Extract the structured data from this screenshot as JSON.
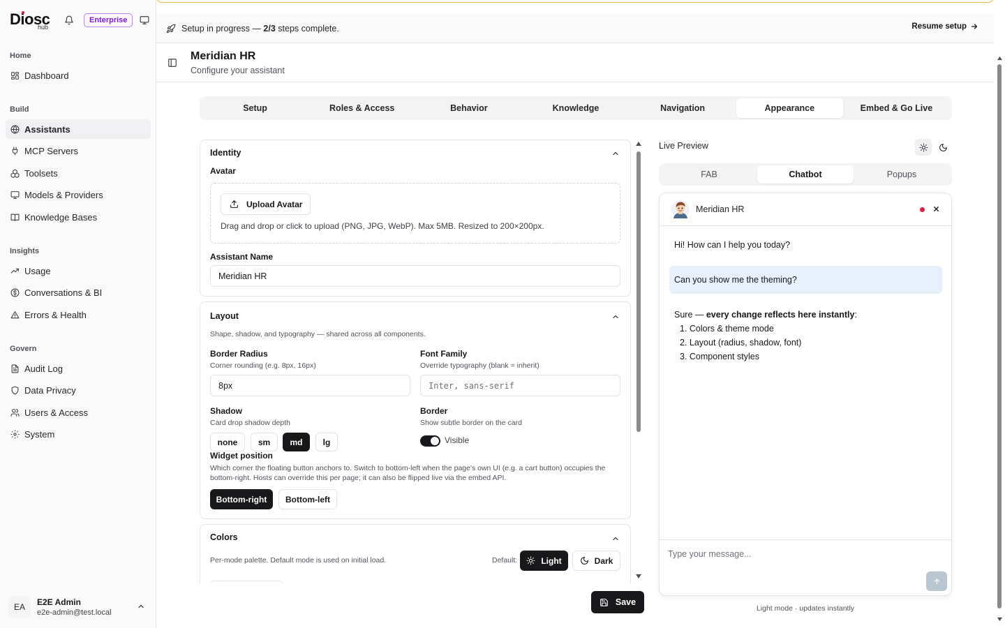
{
  "brand": {
    "logo_text": "Diosc",
    "logo_sub": "hub",
    "plan_badge": "Enterprise",
    "icons": [
      "bell-icon",
      "monitor-icon"
    ]
  },
  "sidebar": {
    "sections": [
      {
        "label": "Home",
        "items": [
          {
            "label": "Dashboard",
            "icon": "dashboard-icon"
          }
        ]
      },
      {
        "label": "Build",
        "items": [
          {
            "label": "Assistants",
            "icon": "globe-icon",
            "active": true
          },
          {
            "label": "MCP Servers",
            "icon": "plug-icon"
          },
          {
            "label": "Toolsets",
            "icon": "cubes-icon"
          },
          {
            "label": "Models & Providers",
            "icon": "monitor-icon"
          },
          {
            "label": "Knowledge Bases",
            "icon": "book-icon"
          }
        ]
      },
      {
        "label": "Insights",
        "items": [
          {
            "label": "Usage",
            "icon": "trend-icon"
          },
          {
            "label": "Conversations & BI",
            "icon": "dollar-circle-icon"
          },
          {
            "label": "Errors & Health",
            "icon": "warning-icon"
          }
        ]
      },
      {
        "label": "Govern",
        "items": [
          {
            "label": "Audit Log",
            "icon": "file-text-icon"
          },
          {
            "label": "Data Privacy",
            "icon": "shield-icon"
          },
          {
            "label": "Users & Access",
            "icon": "users-icon"
          },
          {
            "label": "System",
            "icon": "gear-icon"
          }
        ]
      }
    ],
    "user": {
      "initials": "EA",
      "name": "E2E Admin",
      "email": "e2e-admin@test.local"
    }
  },
  "banner": {
    "prefix": "Setup in progress — ",
    "progress": "2/3",
    "suffix": " steps complete.",
    "resume_label": "Resume setup"
  },
  "header": {
    "title": "Meridian HR",
    "subtitle": "Configure your assistant"
  },
  "tabs": [
    {
      "label": "Setup"
    },
    {
      "label": "Roles & Access"
    },
    {
      "label": "Behavior"
    },
    {
      "label": "Knowledge"
    },
    {
      "label": "Navigation"
    },
    {
      "label": "Appearance",
      "active": true
    },
    {
      "label": "Embed & Go Live"
    }
  ],
  "identity": {
    "title": "Identity",
    "avatar_label": "Avatar",
    "upload_button": "Upload Avatar",
    "upload_help": "Drag and drop or click to upload (PNG, JPG, WebP). Max 5MB. Resized to 200×200px.",
    "name_label": "Assistant Name",
    "name_value": "Meridian HR"
  },
  "layout": {
    "title": "Layout",
    "description": "Shape, shadow, and typography — shared across all components.",
    "border_radius_label": "Border Radius",
    "border_radius_help": "Corner rounding (e.g. 8px, 16px)",
    "border_radius_value": "8px",
    "font_family_label": "Font Family",
    "font_family_help": "Override typography (blank = inherit)",
    "font_family_placeholder": "Inter, sans-serif",
    "shadow_label": "Shadow",
    "shadow_help": "Card drop shadow depth",
    "shadow_options": [
      {
        "label": "none"
      },
      {
        "label": "sm"
      },
      {
        "label": "md",
        "active": true
      },
      {
        "label": "lg"
      }
    ],
    "border_label": "Border",
    "border_help": "Show subtle border on the card",
    "border_toggle_label": "Visible",
    "border_visible": true,
    "widget_position_label": "Widget position",
    "widget_position_help": "Which corner the floating button anchors to. Switch to bottom-left when the page's own UI (e.g. a cart button) occupies the bottom-right. Hosts can override this per page; it can also be flipped live via the embed API.",
    "position_options": [
      {
        "label": "Bottom-right",
        "active": true
      },
      {
        "label": "Bottom-left"
      }
    ]
  },
  "colors": {
    "title": "Colors",
    "description": "Per-mode palette. Default mode is used on initial load.",
    "default_label": "Default:",
    "light_label": "Light",
    "dark_label": "Dark"
  },
  "save_label": "Save",
  "preview": {
    "title": "Live Preview",
    "tabs": [
      {
        "label": "FAB"
      },
      {
        "label": "Chatbot",
        "active": true
      },
      {
        "label": "Popups"
      }
    ],
    "bot_name": "Meridian HR",
    "messages": {
      "bot_greeting": "Hi! How can I help you today?",
      "user_message": "Can you show me the theming?",
      "bot_reply_prefix": "Sure — ",
      "bot_reply_bold": "every change reflects here instantly",
      "bot_reply_suffix": ":",
      "list": [
        "1. Colors & theme mode",
        "2. Layout (radius, shadow, font)",
        "3. Component styles"
      ]
    },
    "input_placeholder": "Type your message...",
    "caption": "Light mode · updates instantly",
    "status_color": "#e11d48",
    "user_bubble_color": "#e8f0fb"
  }
}
